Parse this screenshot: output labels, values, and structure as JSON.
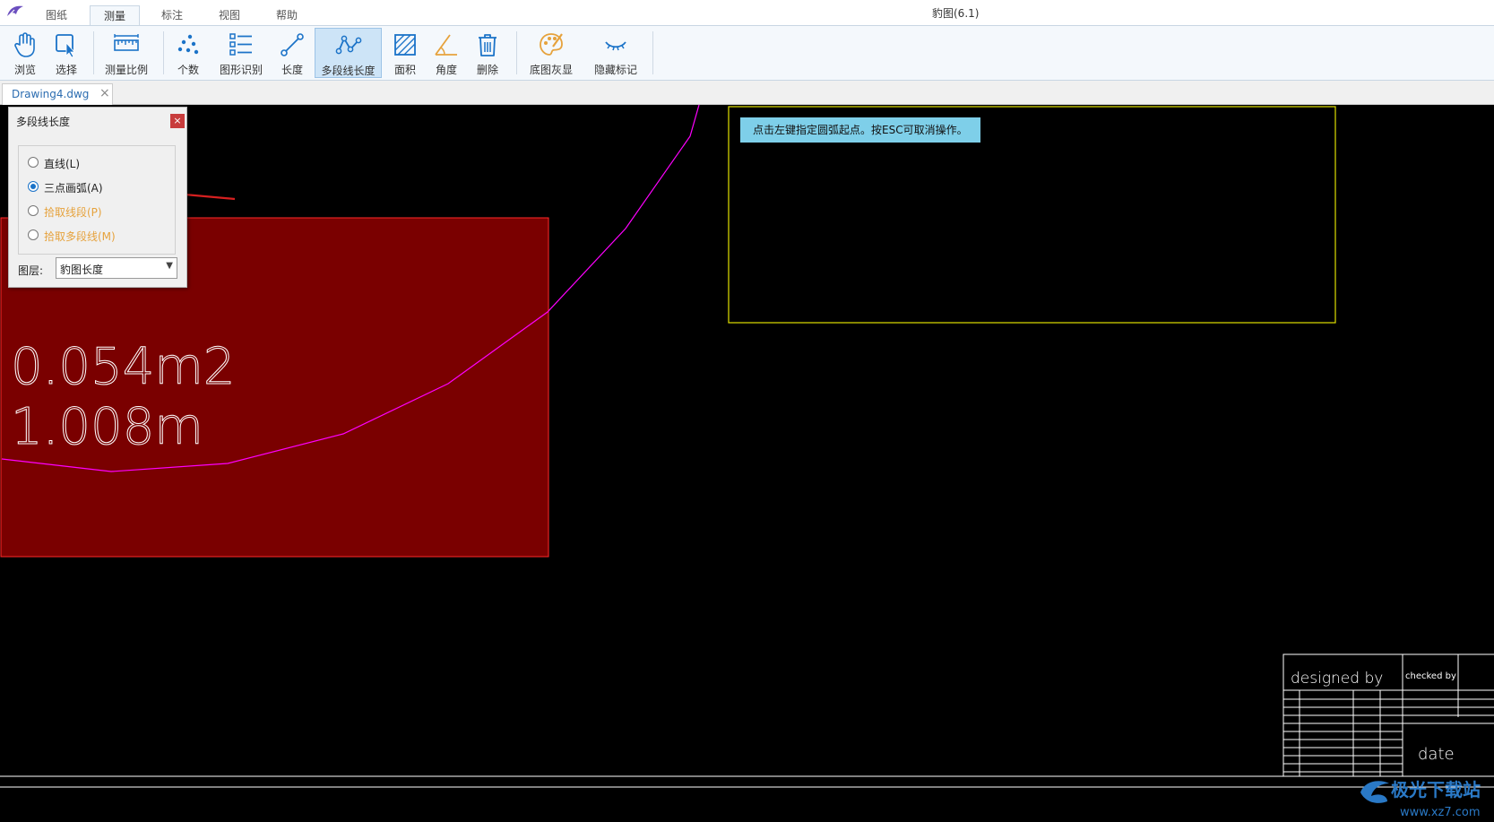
{
  "app": {
    "title": "豹图(6.1)"
  },
  "menu_tabs": [
    {
      "label": "图纸",
      "active": false
    },
    {
      "label": "测量",
      "active": true
    },
    {
      "label": "标注",
      "active": false
    },
    {
      "label": "视图",
      "active": false
    },
    {
      "label": "帮助",
      "active": false
    }
  ],
  "ribbon": {
    "tools": [
      {
        "label": "浏览",
        "icon": "hand-icon"
      },
      {
        "label": "选择",
        "icon": "select-cursor-icon"
      },
      {
        "label": "测量比例",
        "icon": "ruler-icon"
      },
      {
        "label": "个数",
        "icon": "dots-icon"
      },
      {
        "label": "图形识别",
        "icon": "shape-recognition-icon"
      },
      {
        "label": "长度",
        "icon": "line-length-icon"
      },
      {
        "label": "多段线长度",
        "icon": "polyline-icon",
        "active": true
      },
      {
        "label": "面积",
        "icon": "area-icon"
      },
      {
        "label": "角度",
        "icon": "angle-icon"
      },
      {
        "label": "删除",
        "icon": "trash-icon"
      },
      {
        "label": "底图灰显",
        "icon": "palette-icon"
      },
      {
        "label": "隐藏标记",
        "icon": "eye-closed-icon"
      }
    ]
  },
  "document_tab": {
    "label": "Drawing4.dwg",
    "close": "×"
  },
  "drawing": {
    "measurement_area": "0.054m2",
    "measurement_length": "1.008m",
    "hint": "点击左键指定圆弧起点。按ESC可取消操作。",
    "title_block": {
      "designed_by": "designed by",
      "checked_by": "checked by",
      "date": "date"
    },
    "colors": {
      "background": "#000000",
      "region_fill": "#7a0000",
      "polyline": "#ff00ff",
      "frame": "#e0e000",
      "hint_bg": "#7ecfe9"
    }
  },
  "panel": {
    "title": "多段线长度",
    "close": "×",
    "options": [
      {
        "label": "直线(L)",
        "selected": false,
        "color": "#222222"
      },
      {
        "label": "三点画弧(A)",
        "selected": true,
        "color": "#222222"
      },
      {
        "label": "拾取线段(P)",
        "selected": false,
        "color": "#e6a23c"
      },
      {
        "label": "拾取多段线(M)",
        "selected": false,
        "color": "#e6a23c"
      }
    ],
    "layer_label": "图层:",
    "layer_value": "豹图长度"
  },
  "watermark": {
    "text": "极光下载站",
    "url": "www.xz7.com"
  }
}
